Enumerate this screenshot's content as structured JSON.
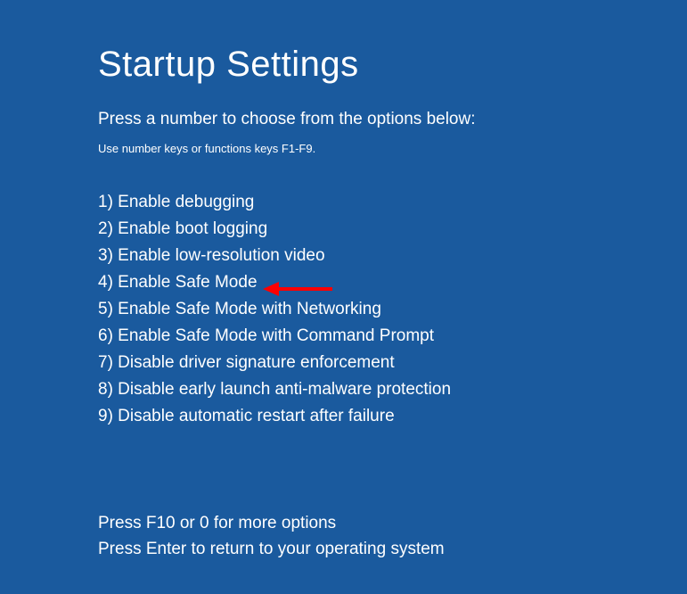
{
  "title": "Startup Settings",
  "subtitle": "Press a number to choose from the options below:",
  "hint": "Use number keys or functions keys F1-F9.",
  "options": [
    "1) Enable debugging",
    "2) Enable boot logging",
    "3) Enable low-resolution video",
    "4) Enable Safe Mode",
    "5) Enable Safe Mode with Networking",
    "6) Enable Safe Mode with Command Prompt",
    "7) Disable driver signature enforcement",
    "8) Disable early launch anti-malware protection",
    "9) Disable automatic restart after failure"
  ],
  "footer": {
    "more": "Press F10 or 0 for more options",
    "return": "Press Enter to return to your operating system"
  },
  "annotation": {
    "arrow_target_index": 3
  }
}
